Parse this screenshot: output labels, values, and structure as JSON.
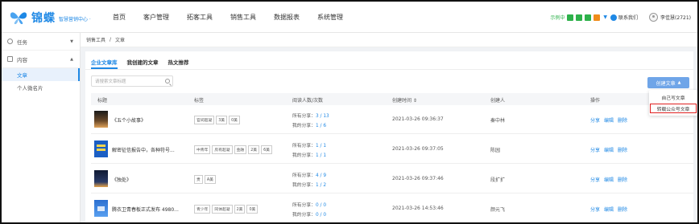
{
  "app": {
    "logo_text": "锦蝶",
    "logo_sub": "智慧营销中心 ·",
    "nav": [
      "首页",
      "客户管理",
      "拓客工具",
      "销售工具",
      "数据报表",
      "系统管理"
    ],
    "status_text": "示例中",
    "status_colors": [
      "#2db14a",
      "#2db14a",
      "#2db14a",
      "#f08c1a"
    ],
    "contact_label": "联系我们",
    "user_label": "李佳慧(2721)",
    "accent_color": "#1e88e5"
  },
  "sidebar": {
    "groups": [
      {
        "label": "任务",
        "icon": "task-icon",
        "items": []
      },
      {
        "label": "内容",
        "icon": "content-icon",
        "items": [
          "文章",
          "个人微名片"
        ]
      }
    ]
  },
  "breadcrumb": [
    "销售工具",
    "/",
    "文章"
  ],
  "tabs": [
    "企业文章库",
    "我创建的文章",
    "热文推荐"
  ],
  "search": {
    "placeholder": "请搜索文章标题"
  },
  "create_button": {
    "label": "创建文章"
  },
  "dropdown": [
    "自己写文章",
    "转载公众号文章"
  ],
  "table": {
    "headers": [
      "标题",
      "标签",
      "阅读人数/次数",
      "创建时间 ⇕",
      "创建人",
      "操作"
    ],
    "share_labels": [
      "所有分享：",
      "我的分享："
    ],
    "rows": [
      {
        "title": "《五个小故事》",
        "tags": [
          "官间超凝",
          "3美",
          "0美"
        ],
        "all_share": "3 / 13",
        "my_share": "1 / 6",
        "time": "2021-03-26 09:36:37",
        "creator": "秦中林",
        "thumb_color": "#3b2a1e"
      },
      {
        "title": "解密征信报告中，各种符号...",
        "tags": [
          "中青年",
          "房有超凝",
          "金融",
          "2美",
          "6美"
        ],
        "all_share": "1 / 1",
        "my_share": "1 / 1",
        "time": "2021-03-26 09:37:05",
        "creator": "陈园",
        "thumb_color": "#1c5fc4"
      },
      {
        "title": "《独处》",
        "tags": [
          "贵",
          "A美"
        ],
        "all_share": "4 / 9",
        "my_share": "1 / 2",
        "time": "2021-03-26 09:37:46",
        "creator": "段扩扩",
        "thumb_color": "#1f2a44"
      },
      {
        "title": "腾衣卫青春板正式发布 4980...",
        "tags": [
          "青少年",
          "同体超凝",
          "2美",
          "0美"
        ],
        "all_share": "0 / 0",
        "my_share": "0 / 0",
        "time": "2021-03-26 14:53:46",
        "creator": "颜元飞",
        "thumb_color": "#2a6fd0"
      }
    ],
    "operations": [
      "分享",
      "编辑",
      "删除"
    ]
  }
}
